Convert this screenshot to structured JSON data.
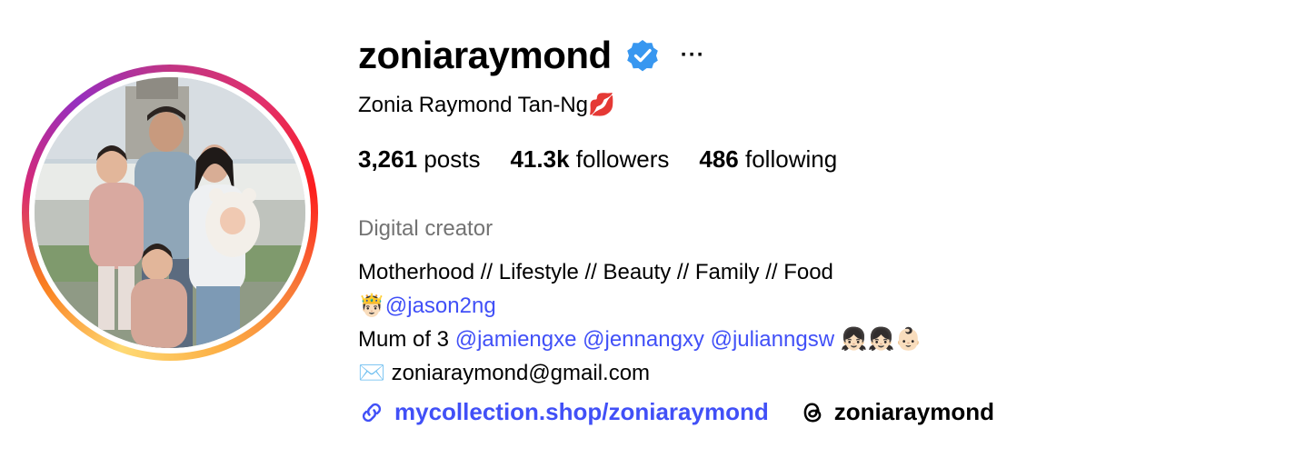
{
  "profile": {
    "username": "zoniaraymond",
    "full_name": "Zonia Raymond Tan-Ng💋",
    "verified": true,
    "more_label": "···"
  },
  "stats": {
    "posts_count": "3,261",
    "posts_label": "posts",
    "followers_count": "41.3k",
    "followers_label": "followers",
    "following_count": "486",
    "following_label": "following"
  },
  "bio": {
    "category": "Digital creator",
    "line1": "Motherhood // Lifestyle // Beauty // Family // Food",
    "line2_emoji": "🤴🏻",
    "line2_mention": "@jason2ng",
    "line3_prefix": "Mum of 3",
    "line3_mentions": [
      "@jamiengxe",
      "@jennangxy",
      "@julianngsw"
    ],
    "line3_emoji": "👧🏻👧🏻👶🏻",
    "line4_emoji": "✉️",
    "line4_email": "zoniaraymond@gmail.com"
  },
  "links": {
    "website": "mycollection.shop/zoniaraymond",
    "threads_handle": "zoniaraymond"
  },
  "colors": {
    "link": "#4150f7",
    "verified": "#3897f0",
    "secondary_text": "#737373"
  }
}
